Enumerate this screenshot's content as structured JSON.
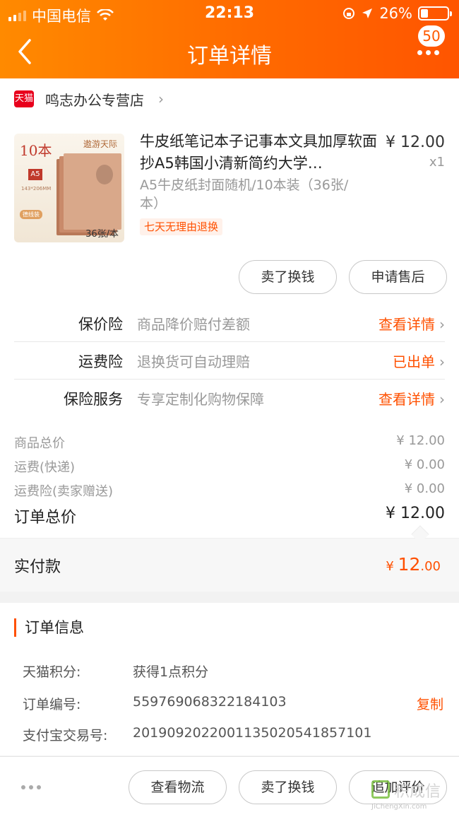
{
  "status_bar": {
    "carrier": "中国电信",
    "time": "22:13",
    "battery": "26%"
  },
  "nav": {
    "title": "订单详情",
    "badge": "50"
  },
  "shop": {
    "logo": "天猫",
    "name": "鸣志办公专营店"
  },
  "product": {
    "title": "牛皮纸笔记本子记事本文具加厚软面抄A5韩国小清新简约大学…",
    "price": "¥ 12.00",
    "qty": "x1",
    "sku": "A5牛皮纸封面随机/10本装（36张/本）",
    "promise": "七天无理由退换",
    "image_texts": {
      "count": "10本",
      "brand": "遨游天际",
      "a5": "A5",
      "size": "143*206MM",
      "tag": "德线装",
      "sheets": "36张/本"
    }
  },
  "product_actions": {
    "sell": "卖了换钱",
    "after_sale": "申请售后"
  },
  "insurance": [
    {
      "name": "保价险",
      "desc": "商品降价赔付差额",
      "action": "查看详情"
    },
    {
      "name": "运费险",
      "desc": "退换货可自动理赔",
      "action": "已出单"
    },
    {
      "name": "保险服务",
      "desc": "专享定制化购物保障",
      "action": "查看详情"
    }
  ],
  "summary": {
    "goods_total": {
      "label": "商品总价",
      "value": "¥ 12.00"
    },
    "shipping": {
      "label": "运费(快递)",
      "value": "¥ 0.00"
    },
    "shipping_ins": {
      "label": "运费险(卖家赠送)",
      "value": "¥ 0.00"
    },
    "order_total": {
      "label": "订单总价",
      "value": "¥ 12.00"
    },
    "paid": {
      "label": "实付款",
      "currency": "¥",
      "int": "12",
      "dec": ".00"
    }
  },
  "order_info": {
    "heading": "订单信息",
    "points_label": "天猫积分:",
    "points_value": "获得1点积分",
    "order_no_label": "订单编号:",
    "order_no": "559769068322184103",
    "copy": "复制",
    "alipay_label": "支付宝交易号:",
    "alipay_no": "2019092022001135020541857101"
  },
  "bottom_bar": {
    "logistics": "查看物流",
    "sell": "卖了换钱",
    "review": "追加评价"
  },
  "watermark": {
    "cn": "积成信",
    "url": "JiChengXin.com"
  },
  "colors": {
    "accent": "#ff5000",
    "header_start": "#ff8a00",
    "header_end": "#ff5500"
  }
}
